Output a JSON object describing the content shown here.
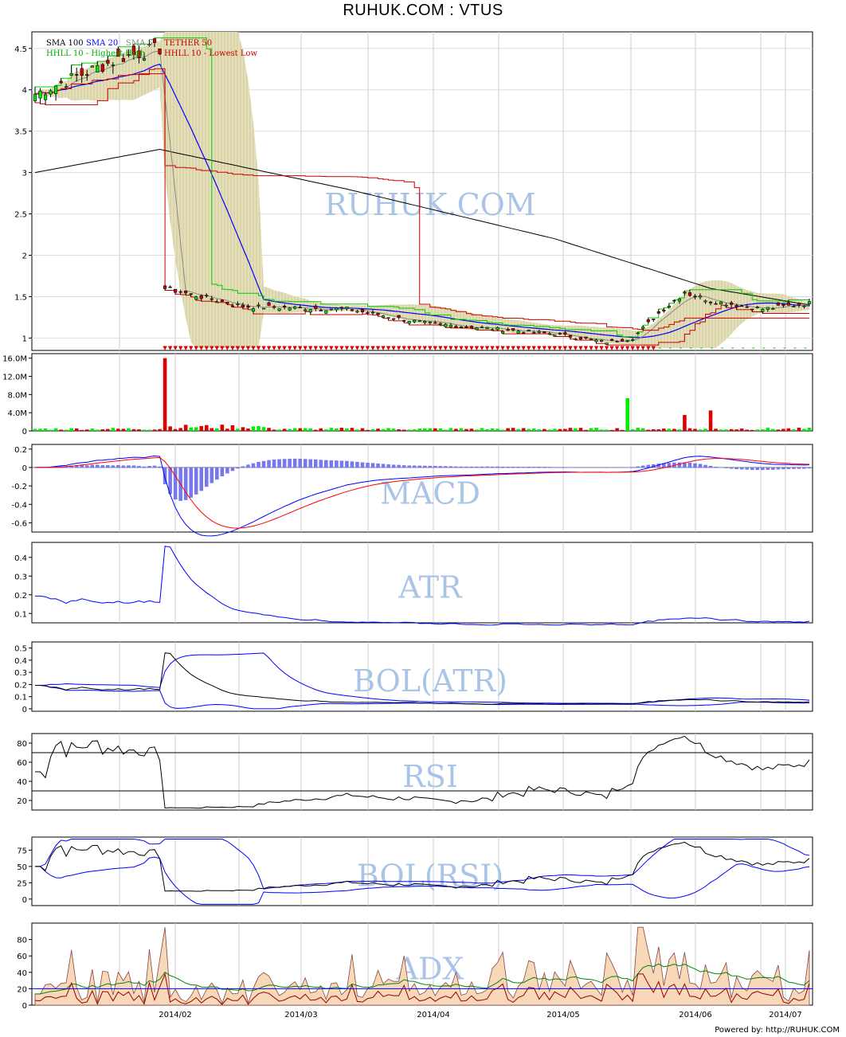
{
  "title": "RUHUK.COM : VTUS",
  "footer": "Powered by: http://RUHUK.COM",
  "x_labels": [
    "2014/02",
    "2014/03",
    "2014/04",
    "2014/05",
    "2014/06",
    "2014/07"
  ],
  "colors": {
    "up": "#00ee00",
    "down": "#dd0000",
    "sma100": "#000000",
    "sma20": "#0000ff",
    "sma5": "#888888",
    "tether": "#cc0000",
    "hh": "#00cc00",
    "ll": "#cc0000",
    "band": "#d8d3a8",
    "watermark": "#a9c4e6",
    "macd_hist": "#7777ee"
  },
  "chart_data": [
    {
      "type": "candlestick",
      "panel": "price",
      "watermark": "RUHUK.COM",
      "legend": [
        "SMA 100",
        "SMA 20",
        "SMA 5",
        "TETHER 50",
        "HHLL 10 - Highest High",
        "HHLL 10 - Lowest Low"
      ],
      "yticks": [
        4.5,
        4,
        3.5,
        3,
        2.5,
        2,
        1.5,
        1
      ],
      "ylim": [
        0.85,
        4.7
      ],
      "bars": 150,
      "approx_close_path": [
        [
          0,
          3.95
        ],
        [
          17,
          4.4
        ],
        [
          24,
          4.5
        ],
        [
          25,
          1.6
        ],
        [
          40,
          1.38
        ],
        [
          60,
          1.35
        ],
        [
          75,
          1.18
        ],
        [
          100,
          1.05
        ],
        [
          110,
          0.95
        ],
        [
          115,
          1.0
        ],
        [
          120,
          1.3
        ],
        [
          125,
          1.55
        ],
        [
          130,
          1.45
        ],
        [
          140,
          1.35
        ],
        [
          149,
          1.42
        ]
      ],
      "sma100_path": [
        [
          0,
          3.0
        ],
        [
          24,
          3.28
        ],
        [
          60,
          2.8
        ],
        [
          100,
          2.2
        ],
        [
          130,
          1.6
        ],
        [
          149,
          1.4
        ]
      ]
    },
    {
      "type": "bar",
      "panel": "volume",
      "yticks": [
        "16.0M",
        "12.0M",
        "8.0M",
        "4.0M",
        "0"
      ],
      "ylim": [
        0,
        17000000
      ],
      "peaks": [
        [
          25,
          16000000
        ],
        [
          114,
          7200000
        ],
        [
          125,
          3500000
        ],
        [
          130,
          4500000
        ]
      ]
    },
    {
      "type": "line",
      "panel": "macd",
      "watermark": "MACD",
      "yticks": [
        "0.2",
        "0",
        "-0.2",
        "-0.4",
        "-0.6"
      ],
      "ylim": [
        -0.7,
        0.25
      ]
    },
    {
      "type": "line",
      "panel": "atr",
      "watermark": "ATR",
      "yticks": [
        "0.4",
        "0.3",
        "0.2",
        "0.1"
      ],
      "ylim": [
        0.05,
        0.48
      ]
    },
    {
      "type": "line",
      "panel": "bol_atr",
      "watermark": "BOL(ATR)",
      "yticks": [
        "0.5",
        "0.4",
        "0.3",
        "0.2",
        "0.1",
        "0"
      ],
      "ylim": [
        -0.02,
        0.55
      ]
    },
    {
      "type": "line",
      "panel": "rsi",
      "watermark": "RSI",
      "yticks": [
        "80",
        "60",
        "40",
        "20"
      ],
      "ylim": [
        10,
        90
      ],
      "levels": [
        70,
        30
      ]
    },
    {
      "type": "line",
      "panel": "bol_rsi",
      "watermark": "BOL(RSI)",
      "yticks": [
        "75",
        "50",
        "25",
        "0"
      ],
      "ylim": [
        -10,
        95
      ]
    },
    {
      "type": "area",
      "panel": "adx",
      "watermark": "ADX",
      "yticks": [
        "80",
        "60",
        "40",
        "20",
        "0"
      ],
      "ylim": [
        0,
        100
      ],
      "level": 20
    }
  ]
}
